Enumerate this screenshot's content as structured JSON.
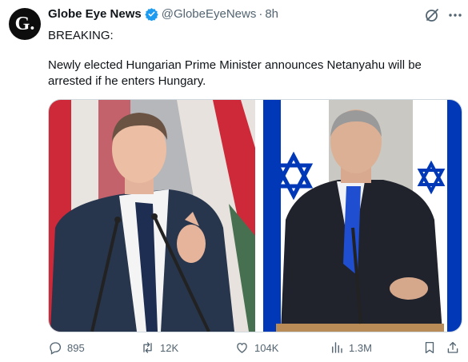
{
  "author": {
    "avatar_letter": "G.",
    "name": "Globe Eye News",
    "handle": "@GlobeEyeNews",
    "time": "8h"
  },
  "tweet": {
    "line1": "BREAKING:",
    "line2": "Newly elected Hungarian Prime Minister announces Netanyahu will be arrested if he enters Hungary."
  },
  "actions": {
    "replies": "895",
    "reposts": "12K",
    "likes": "104K",
    "views": "1.3M"
  },
  "colors": {
    "verified": "#1d9bf0",
    "text": "#0f1419",
    "muted": "#536471",
    "hungary_red": "#ce2939",
    "hungary_green": "#477050",
    "israel_blue": "#0038b8"
  },
  "icons": [
    "verified-badge-icon",
    "grok-icon",
    "more-icon",
    "reply-icon",
    "repost-icon",
    "like-icon",
    "views-icon",
    "bookmark-icon",
    "share-icon"
  ]
}
